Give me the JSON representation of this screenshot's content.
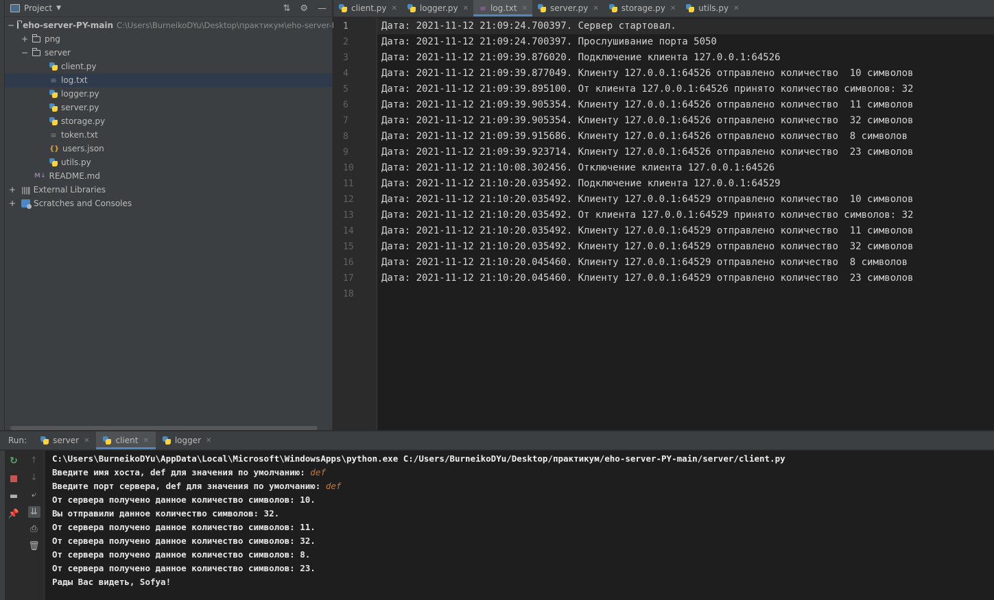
{
  "project": {
    "title": "Project",
    "root_name": "eho-server-PY-main",
    "root_path": "C:\\Users\\BurneikoDYu\\Desktop\\практикум\\eho-server-PY-",
    "png_folder": "png",
    "server_folder": "server",
    "files": [
      "client.py",
      "log.txt",
      "logger.py",
      "server.py",
      "storage.py",
      "token.txt",
      "users.json",
      "utils.py"
    ],
    "readme": "README.md",
    "external_libraries": "External Libraries",
    "scratches": "Scratches and Consoles"
  },
  "editor": {
    "tabs": [
      "client.py",
      "logger.py",
      "log.txt",
      "server.py",
      "storage.py",
      "utils.py"
    ],
    "active_tab": "log.txt",
    "line_numbers": [
      "1",
      "2",
      "3",
      "4",
      "5",
      "6",
      "7",
      "8",
      "9",
      "10",
      "11",
      "12",
      "13",
      "14",
      "15",
      "16",
      "17",
      "18"
    ],
    "lines": [
      "Дата: 2021-11-12 21:09:24.700397. Сервер стартовал.",
      "Дата: 2021-11-12 21:09:24.700397. Прослушивание порта 5050",
      "Дата: 2021-11-12 21:09:39.876020. Подключение клиента 127.0.0.1:64526",
      "Дата: 2021-11-12 21:09:39.877049. Клиенту 127.0.0.1:64526 отправлено количество  10 символов",
      "Дата: 2021-11-12 21:09:39.895100. От клиента 127.0.0.1:64526 принято количество символов: 32",
      "Дата: 2021-11-12 21:09:39.905354. Клиенту 127.0.0.1:64526 отправлено количество  11 символов",
      "Дата: 2021-11-12 21:09:39.905354. Клиенту 127.0.0.1:64526 отправлено количество  32 символов",
      "Дата: 2021-11-12 21:09:39.915686. Клиенту 127.0.0.1:64526 отправлено количество  8 символов",
      "Дата: 2021-11-12 21:09:39.923714. Клиенту 127.0.0.1:64526 отправлено количество  23 символов",
      "Дата: 2021-11-12 21:10:08.302456. Отключение клиента 127.0.0.1:64526",
      "Дата: 2021-11-12 21:10:20.035492. Подключение клиента 127.0.0.1:64529",
      "Дата: 2021-11-12 21:10:20.035492. Клиенту 127.0.0.1:64529 отправлено количество  10 символов",
      "Дата: 2021-11-12 21:10:20.035492. От клиента 127.0.0.1:64529 принято количество символов: 32",
      "Дата: 2021-11-12 21:10:20.035492. Клиенту 127.0.0.1:64529 отправлено количество  11 символов",
      "Дата: 2021-11-12 21:10:20.035492. Клиенту 127.0.0.1:64529 отправлено количество  32 символов",
      "Дата: 2021-11-12 21:10:20.045460. Клиенту 127.0.0.1:64529 отправлено количество  8 символов",
      "Дата: 2021-11-12 21:10:20.045460. Клиенту 127.0.0.1:64529 отправлено количество  23 символов",
      ""
    ]
  },
  "run": {
    "label": "Run:",
    "tabs": [
      "server",
      "client",
      "logger"
    ],
    "active_tab": "client",
    "console": {
      "command": "C:\\Users\\BurneikoDYu\\AppData\\Local\\Microsoft\\WindowsApps\\python.exe C:/Users/BurneikoDYu/Desktop/практикум/eho-server-PY-main/server/client.py",
      "prompt_host": "Введите имя хоста, def для значения по умолчанию: ",
      "input_host": "def",
      "prompt_port": "Введите порт сервера, def для значения по умолчанию: ",
      "input_port": "def",
      "output": [
        "От сервера получено данное количество символов: 10.",
        "Вы отправили данное количество символов: 32.",
        "От сервера получено данное количество символов: 11.",
        "От сервера получено данное количество символов: 32.",
        "От сервера получено данное количество символов: 8.",
        "От сервера получено данное количество символов: 23.",
        "Рады Вас видеть, Sofya!"
      ]
    }
  },
  "colors": {
    "accent": "#4a88c7",
    "panel_bg": "#3c3f41",
    "editor_bg": "#1e1e1e",
    "rerun_green": "#59a869",
    "stop_red": "#c75450",
    "input_orange": "#cc7832"
  }
}
